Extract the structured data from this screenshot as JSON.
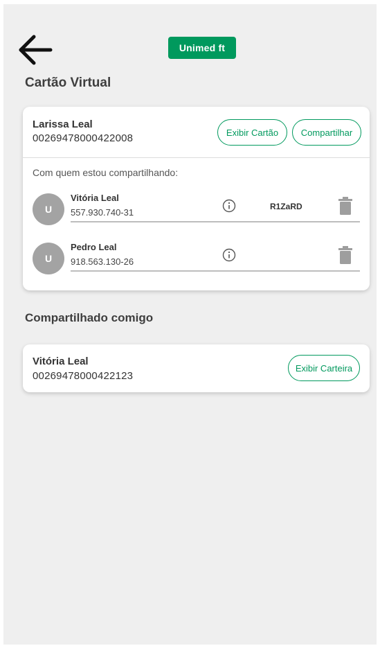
{
  "header": {
    "logo_text": "Unimed ft",
    "back_icon": "arrow-left-icon"
  },
  "virtual_card": {
    "section_title": "Cartão Virtual",
    "owner_name": "Larissa Leal",
    "owner_number": "00269478000422008",
    "show_card_label": "Exibir Cartão",
    "share_label": "Compartilhar",
    "sharing_with_label": "Com quem estou compartilhando:",
    "shares": [
      {
        "avatar_initial": "U",
        "name": "Vitória Leal",
        "cpf": "557.930.740-31",
        "code": "R1ZaRD"
      },
      {
        "avatar_initial": "U",
        "name": "Pedro Leal",
        "cpf": "918.563.130-26",
        "code": ""
      }
    ]
  },
  "shared_with_me": {
    "section_title": "Compartilhado comigo",
    "name": "Vitória Leal",
    "number": "00269478000422123",
    "show_wallet_label": "Exibir Carteira"
  },
  "colors": {
    "brand_green": "#00995d",
    "background": "#efefef",
    "card": "#ffffff",
    "avatar_gray": "#a3a3a3"
  }
}
